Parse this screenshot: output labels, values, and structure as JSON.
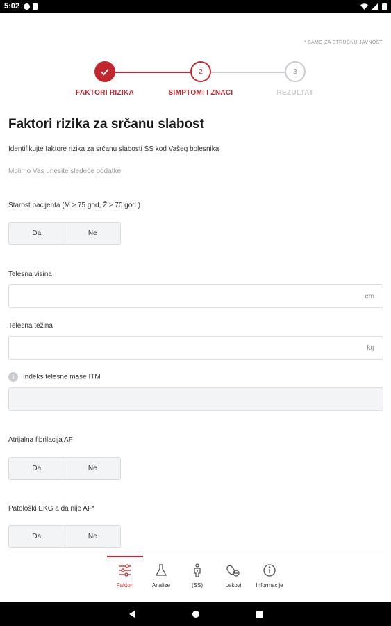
{
  "status": {
    "time": "5:02"
  },
  "disclaimer": "* SAMO ZA STRUČNU JAVNOST",
  "stepper": {
    "steps": [
      {
        "label": "FAKTORI RIZIKA",
        "number": "",
        "state": "done"
      },
      {
        "label": "SIMPTOMI I ZNACI",
        "number": "2",
        "state": "active"
      },
      {
        "label": "REZULTAT",
        "number": "3",
        "state": "pending"
      }
    ]
  },
  "title": "Faktori rizika za srčanu slabost",
  "subtitle": "Identifikujte faktore rizika za srčanu slabosti SS kod Vašeg bolesnika",
  "hint": "Molimo Vas unesite sledeće podatke",
  "questions": {
    "age": {
      "label": "Starost pacijenta (M ≥ 75 god, Ž ≥ 70 god )",
      "yes": "Da",
      "no": "Ne"
    },
    "height": {
      "label": "Telesna visina",
      "value": "",
      "unit": "cm"
    },
    "weight": {
      "label": "Telesna težina",
      "value": "",
      "unit": "kg"
    },
    "bmi": {
      "label": "Indeks telesne mase ITM",
      "value": "",
      "info": "i"
    },
    "af": {
      "label": "Atrijalna fibrilacija AF",
      "yes": "Da",
      "no": "Ne"
    },
    "ekg": {
      "label": "Patološki EKG a da nije AF*",
      "yes": "Da",
      "no": "Ne"
    }
  },
  "bottom_nav": [
    {
      "label": "Faktori",
      "icon": "sliders-icon",
      "active": true
    },
    {
      "label": "Analize",
      "icon": "flask-icon",
      "active": false
    },
    {
      "label": "(SS)",
      "icon": "heart-body-icon",
      "active": false
    },
    {
      "label": "Lekovi",
      "icon": "pills-icon",
      "active": false
    },
    {
      "label": "Informacije",
      "icon": "info-circle-icon",
      "active": false
    }
  ],
  "colors": {
    "accent": "#c4262e",
    "muted": "#c9ccd1",
    "border": "#d9dce0"
  }
}
